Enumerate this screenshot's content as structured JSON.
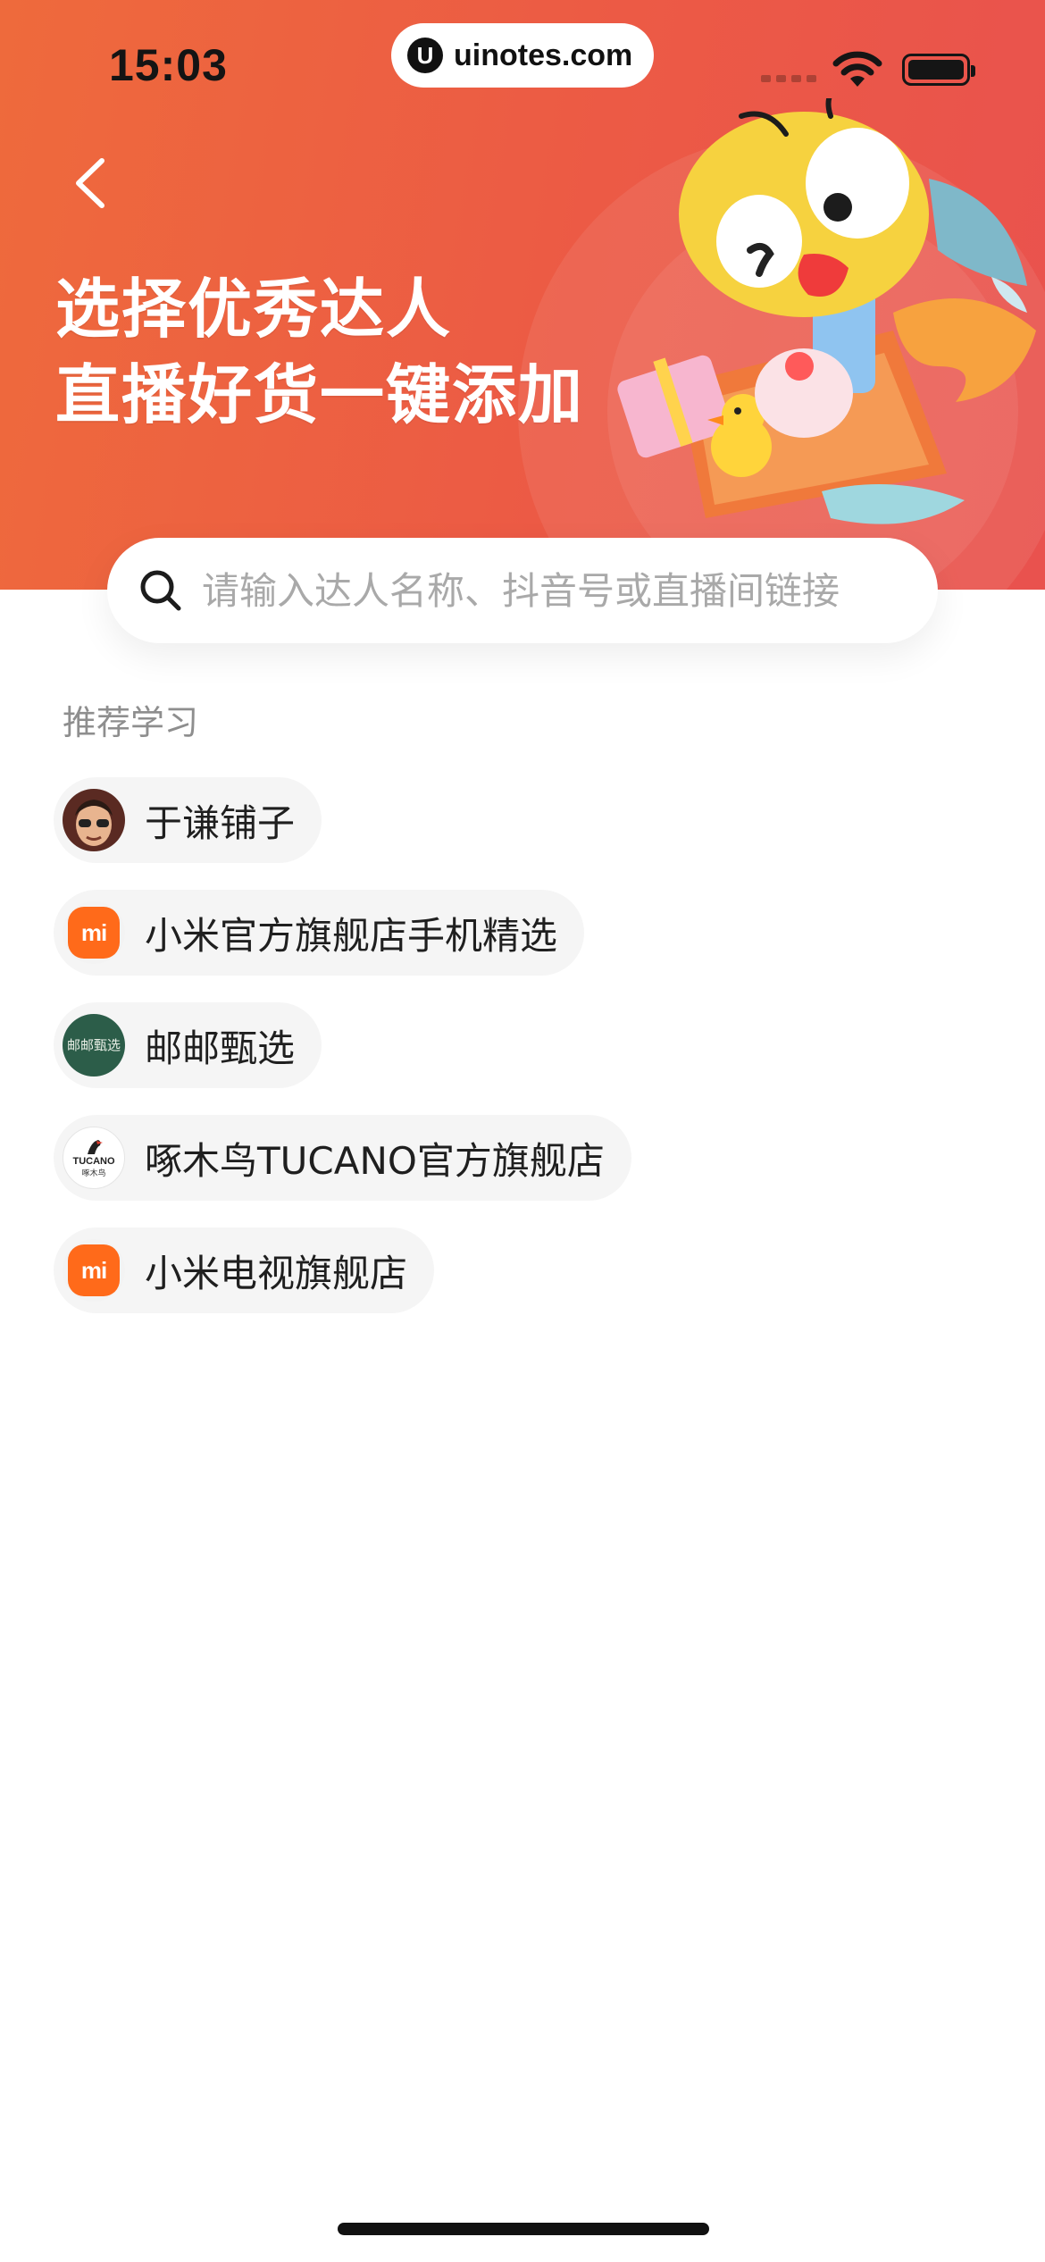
{
  "status_bar": {
    "time": "15:03",
    "watermark": "uinotes.com",
    "watermark_logo": "U"
  },
  "header": {
    "back_icon": "chevron-left-icon",
    "headline_line1": "选择优秀达人",
    "headline_line2": "直播好货一键添加",
    "mascot": "cartoon-mascot-with-gifts"
  },
  "search": {
    "icon": "search-icon",
    "placeholder": "请输入达人名称、抖音号或直播间链接",
    "value": ""
  },
  "recommend": {
    "title": "推荐学习",
    "items": [
      {
        "label": "于谦铺子",
        "avatar": "person-avatar"
      },
      {
        "label": "小米官方旗舰店手机精选",
        "avatar": "xiaomi-logo",
        "avatar_text": "mi"
      },
      {
        "label": "邮邮甄选",
        "avatar": "green-calligraphy-logo",
        "avatar_text": "邮邮甄选"
      },
      {
        "label": "啄木鸟TUCANO官方旗舰店",
        "avatar": "tucano-logo",
        "avatar_text": "TUCANO",
        "avatar_subtext": "啄木鸟"
      },
      {
        "label": "小米电视旗舰店",
        "avatar": "xiaomi-logo",
        "avatar_text": "mi"
      }
    ]
  },
  "colors": {
    "banner_start": "#ee6a3c",
    "banner_end": "#e9524e",
    "xiaomi_orange": "#ff6a1a",
    "chip_bg": "#f5f5f5"
  }
}
